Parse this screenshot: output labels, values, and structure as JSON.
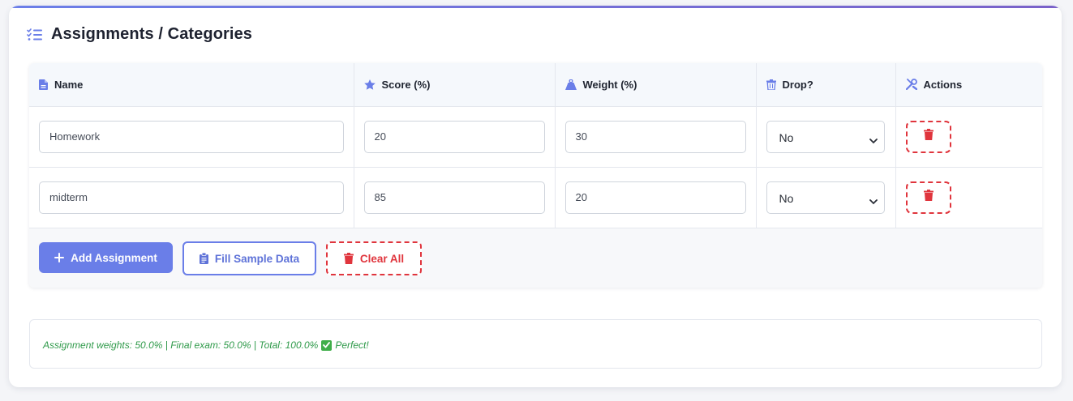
{
  "section": {
    "title": "Assignments / Categories"
  },
  "colors": {
    "accent": "#6a7ee8",
    "danger": "#e0353d",
    "success": "#2f9a4a"
  },
  "table": {
    "columns": [
      {
        "label": "Name",
        "icon": "file-icon"
      },
      {
        "label": "Score (%)",
        "icon": "star-icon"
      },
      {
        "label": "Weight (%)",
        "icon": "weight-icon"
      },
      {
        "label": "Drop?",
        "icon": "trash-icon"
      },
      {
        "label": "Actions",
        "icon": "tools-icon"
      }
    ],
    "rows": [
      {
        "name": "Homework",
        "score": "20",
        "weight": "30",
        "drop": "No"
      },
      {
        "name": "midterm",
        "score": "85",
        "weight": "20",
        "drop": "No"
      }
    ]
  },
  "buttons": {
    "add": "Add Assignment",
    "fill": "Fill Sample Data",
    "clear": "Clear All"
  },
  "summary": {
    "text": "Assignment weights: 50.0% | Final exam: 50.0% | Total: 100.0%",
    "status": "Perfect!"
  }
}
